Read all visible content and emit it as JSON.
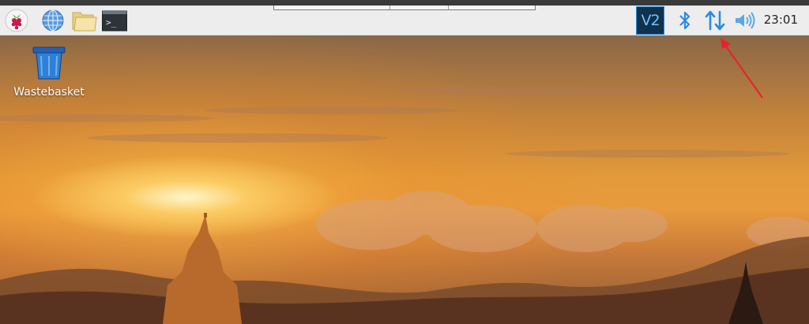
{
  "taskbar": {
    "launchers": [
      {
        "name": "raspberry-menu",
        "icon": "raspberry-pi-icon"
      },
      {
        "name": "web-browser",
        "icon": "globe-icon"
      },
      {
        "name": "file-manager",
        "icon": "folder-icon"
      },
      {
        "name": "terminal",
        "icon": "terminal-icon",
        "glyph": ">_"
      }
    ],
    "tray": {
      "vnc_label": "V2",
      "bluetooth_icon": "bluetooth-icon",
      "network_icon": "network-arrows-icon",
      "volume_icon": "volume-icon"
    },
    "clock": "23:01"
  },
  "desktop": {
    "icons": [
      {
        "label": "Wastebasket",
        "icon": "wastebasket-icon"
      }
    ]
  },
  "colors": {
    "tray_blue": "#2a8be0",
    "vnc_bg": "#10324d",
    "annotation_arrow": "#e8212b"
  }
}
